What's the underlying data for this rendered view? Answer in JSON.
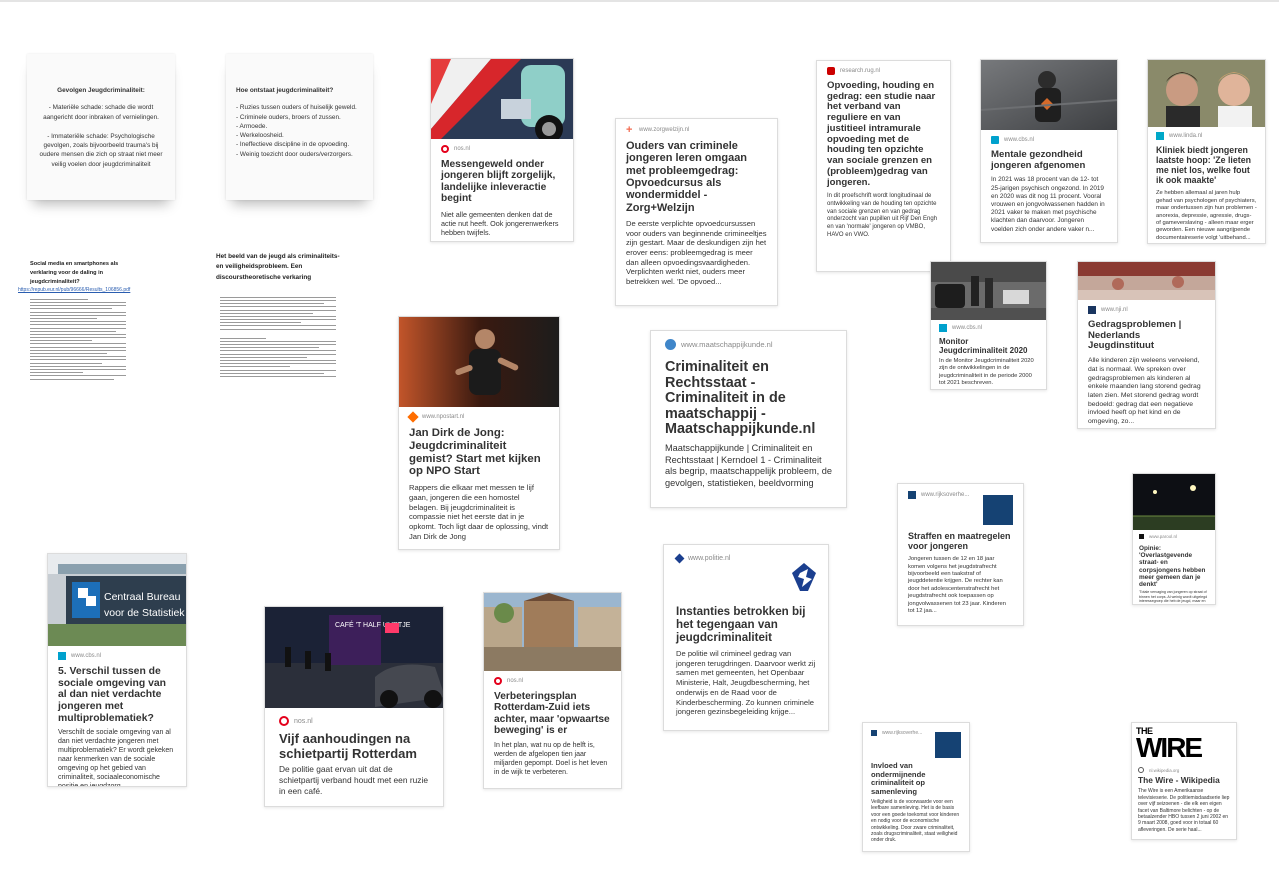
{
  "notes": [
    {
      "title": "Gevolgen Jeugdcriminaliteit:",
      "lines": [
        "- Materiële schade: schade die wordt aangericht door inbraken of vernielingen.",
        "- Immateriële schade: Psychologische gevolgen, zoals bijvoorbeeld trauma's bij oudere mensen die zich op straat niet meer veilig voelen door jeugdcriminaliteit"
      ]
    },
    {
      "title": "Hoe ontstaat jeugdcriminaliteit?",
      "lines": [
        "- Ruzies tussen ouders of huiselijk geweld.",
        "- Criminele ouders, broers of zussen.",
        "- Armoede.",
        "- Werkeloosheid.",
        "- Ineffectieve discipline in de opvoeding.",
        "- Weinig toezicht door ouders/verzorgers."
      ]
    }
  ],
  "docs": [
    {
      "title": "Social media en smartphones als verklaring voor de daling in jeugdcriminaliteit?",
      "link": "https://repub.eur.nl/pub/96666/Results_106856.pdf"
    },
    {
      "title": "Het beeld van de jeugd als criminaliteits- en veiligheidsprobleem. Een discourstheoretische verkaring",
      "link": ""
    }
  ],
  "cards": {
    "nos1": {
      "source": "nos.nl",
      "title": "Messengeweld onder jongeren blijft zorgelijk, landelijke inleveractie begint",
      "desc": "Niet alle gemeenten denken dat de actie nut heeft. Ook jongerenwerkers hebben twijfels."
    },
    "zorg": {
      "source": "www.zorgwelzijn.nl",
      "title": "Ouders van criminele jongeren leren omgaan met probleemgedrag: Opvoedcursus als wondermiddel - Zorg+Welzijn",
      "desc": "De eerste verplichte opvoedcursussen voor ouders van beginnende crimineeltjes zijn gestart. Maar de deskundigen zijn het erover eens: probleemgedrag is meer dan alleen opvoedingsvaardigheden. Verplichten werkt niet, ouders meer betrekken wel. 'De opvoed..."
    },
    "rug": {
      "source": "research.rug.nl",
      "title": "Opvoeding, houding en gedrag: een studie naar het verband van reguliere en van justitieel intramurale opvoeding met de houding ten opzichte van sociale grenzen en (probleem)gedrag van jongeren.",
      "desc": "In dit proefschrift wordt longitudinaal de ontwikkeling van de houding ten opzichte van sociale grenzen en van gedrag onderzocht van pupillen uit Rijf Den Engh en van 'normale' jongeren op VMBO, HAVO en VWO."
    },
    "cbs1": {
      "source": "www.cbs.nl",
      "title": "Mentale gezondheid jongeren afgenomen",
      "desc": "In 2021 was 18 procent van de 12- tot 25-jarigen psychisch ongezond. In 2019 en 2020 was dit nog 11 procent. Vooral vrouwen en jongvolwassenen hadden in 2021 vaker te maken met psychische klachten dan daarvoor. Jongeren voelden zich onder andere vaker n..."
    },
    "linda": {
      "source": "www.linda.nl",
      "title": "Kliniek biedt jongeren laatste hoop: 'Ze lieten me niet los, welke fout ik ook maakte'",
      "desc": "Ze hebben allemaal al jaren hulp gehad van psychologen of psychiaters, maar ondertussen zijn hun problemen - anorexia, depressie, agressie, drugs- of gameverslaving - alleen maar erger geworden. Een nieuwe aangrijpende documentaireserie volgt 'uitbehand..."
    },
    "npo": {
      "source": "www.npostart.nl",
      "title": "Jan Dirk de Jong: Jeugdcriminaliteit gemist? Start met kijken op NPO Start",
      "desc": "Rappers die elkaar met messen te lijf gaan, jongeren die een homostel belagen. Bij jeugdcriminaliteit is compassie niet het eerste dat in je opkomt. Toch ligt daar de oplossing, vindt Jan Dirk de Jong"
    },
    "maatsch": {
      "source": "www.maatschappijkunde.nl",
      "title": "Criminaliteit en Rechtsstaat - Criminaliteit in de maatschappij - Maatschappijkunde.nl",
      "desc": "Maatschappijkunde | Criminaliteit en Rechtsstaat | Kerndoel 1 - Criminaliteit als begrip, maatschappelijk probleem, de gevolgen, statistieken, beeldvorming"
    },
    "cbs2": {
      "source": "www.cbs.nl",
      "title": "Monitor Jeugdcriminaliteit 2020",
      "desc": "In de Monitor Jeugdcriminaliteit 2020 zijn de ontwikkelingen in de jeugdcriminaliteit in de periode 2000 tot 2021 beschreven."
    },
    "nji": {
      "source": "www.nji.nl",
      "title": "Gedragsproblemen | Nederlands Jeugdinstituut",
      "desc": "Alle kinderen zijn weleens vervelend, dat is normaal. We spreken over gedragsproblemen als kinderen al enkele maanden lang storend gedrag laten zien. Met storend gedrag wordt bedoeld: gedrag dat een negatieve invloed heeft op het kind en de omgeving, zo..."
    },
    "straf": {
      "source": "www.rijksoverhe...",
      "title": "Straffen en maatregelen voor jongeren",
      "desc": "Jongeren tussen de 12 en 18 jaar komen volgens het jeugdstrafrecht bijvoorbeeld een taakstraf of jeugddetentie krijgen. De rechter kan door het adolescentenstrafrecht het jeugdstrafrecht ook toepassen op jongvolwassenen tot 23 jaar. Kinderen tot 12 jaa..."
    },
    "opinie": {
      "source": "www.parool.nl",
      "title": "Opinie: 'Overlastgevende straat- en corpsjongens hebben meer gemeen dan je denkt'",
      "desc": "'Totale vervaging van jongeren op straat of binnen het corps. Al weinig wordt uitgelegd interessegroep die heb de jeugd, maar en mischtie strijd. Wie...'"
    },
    "cbs3": {
      "source": "www.cbs.nl",
      "title": "5. Verschil tussen de sociale omgeving van al dan niet verdachte jongeren met multiproblematiek?",
      "desc": "Verschilt de sociale omgeving van al dan niet verdachte jongeren met multiproblematiek? Er wordt gekeken naar kenmerken van de sociale omgeving op het gebied van criminaliteit, sociaaleconomische positie en jeugdzorg."
    },
    "nos2": {
      "source": "nos.nl",
      "title": "Vijf aanhoudingen na schietpartij Rotterdam",
      "desc": "De politie gaat ervan uit dat de schietpartij verband houdt met een ruzie in een café."
    },
    "nos3": {
      "source": "nos.nl",
      "title": "Verbeteringsplan Rotterdam-Zuid iets achter, maar 'opwaartse beweging' is er",
      "desc": "In het plan, wat nu op de helft is, werden de afgelopen tien jaar miljarden gepompt. Doel is het leven in de wijk te verbeteren."
    },
    "politie": {
      "source": "www.politie.nl",
      "title": "Instanties betrokken bij het tegengaan van jeugdcriminaliteit",
      "desc": "De politie wil crimineel gedrag van jongeren terugdringen. Daarvoor werkt zij samen met gemeenten, het Openbaar Ministerie, Halt, Jeugdbescherming, het onderwijs en de Raad voor de Kinderbescherming. Zo kunnen criminele jongeren gezinsbegeleiding krijge..."
    },
    "ondermijn": {
      "source": "www.rijksoverhe...",
      "title": "Invloed van ondermijnende criminaliteit op samenleving",
      "desc": "Veiligheid is de voorwaarde voor een leefbare samenleving. Het is de basis voor een goede toekomst voor kinderen en nodig voor de economische ontwikkeling. Door zware criminaliteit, zoals drugscriminaliteit, staat veiligheid onder druk."
    },
    "wire": {
      "source": "nl.wikipedia.org",
      "title": "The Wire - Wikipedia",
      "desc": "The Wire is een Amerikaanse televisieserie. De politiemisdaadserie liep over vijf seizoenen - die elk een eigen facet van Baltimore belichten - op de betaalzender HBO tussen 2 juni 2002 en 9 maart 2008, goed voor in totaal 60 afleveringen. De serie haal..."
    }
  },
  "cbs_sign": {
    "line1": "Centraal Bureau",
    "line2": "voor de Statistiek"
  },
  "cafe_sign": "CAFÉ 'T HALF UURTJE",
  "wire_logo": {
    "line1": "THE",
    "line2": "WIRE"
  },
  "colors": {
    "nos": "#e4001b",
    "cbs": "#00a1cd",
    "rijks": "#154273",
    "politie": "#1b3f8f",
    "npo": "#ff6d00"
  }
}
